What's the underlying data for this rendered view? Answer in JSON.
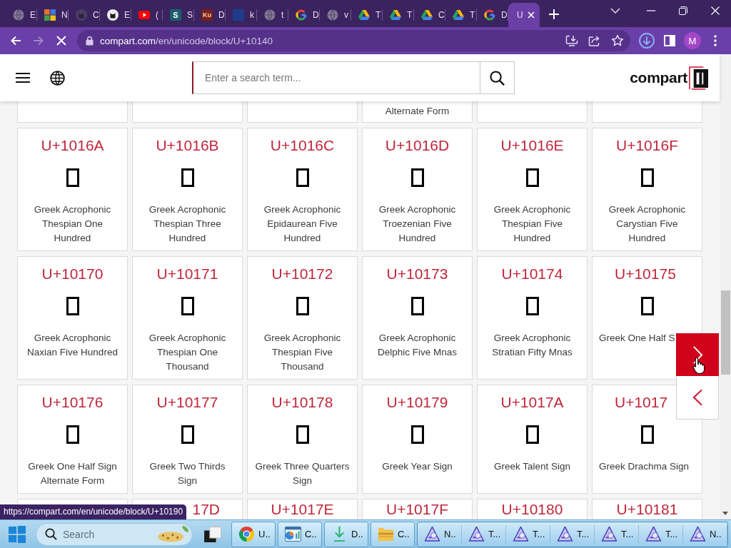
{
  "browser": {
    "tabs": [
      {
        "title": "E",
        "selected": false
      },
      {
        "title": "N",
        "selected": false
      },
      {
        "title": "C",
        "selected": false
      },
      {
        "title": "E",
        "selected": false
      },
      {
        "title": "(",
        "selected": false
      },
      {
        "title": "S",
        "logo_text": "S",
        "selected": false
      },
      {
        "title": "D",
        "logo_text": "Ku",
        "selected": false
      },
      {
        "title": "k",
        "selected": false
      },
      {
        "title": "t",
        "selected": false
      },
      {
        "title": "D",
        "selected": false
      },
      {
        "title": "v",
        "selected": false
      },
      {
        "title": "T",
        "selected": false
      },
      {
        "title": "T",
        "selected": false
      },
      {
        "title": "C",
        "selected": false
      },
      {
        "title": "T",
        "selected": false
      },
      {
        "title": "D",
        "selected": false
      },
      {
        "title": "U",
        "selected": true
      }
    ],
    "forward_disabled": true,
    "loading": true,
    "address": {
      "host": "compart.com",
      "path": "/en/unicode/block/U+10140"
    },
    "profile_initial": "M"
  },
  "site_header": {
    "search_placeholder": "Enter a search term...",
    "logo": "compart"
  },
  "cards": [
    {
      "kind": "tail"
    },
    {
      "kind": "tail"
    },
    {
      "kind": "tail"
    },
    {
      "kind": "tail",
      "name": "Alternate Form",
      "start_hidden": false,
      "end_hidden": false
    },
    {
      "kind": "tail"
    },
    {
      "kind": "tail"
    },
    {
      "kind": "full",
      "code": "U+1016A",
      "name": "Greek Acrophonic Thespian One Hundred",
      "start_hidden": false,
      "end_hidden": false
    },
    {
      "kind": "full",
      "code": "U+1016B",
      "name": "Greek Acrophonic Thespian Three Hundred",
      "start_hidden": false,
      "end_hidden": false
    },
    {
      "kind": "full",
      "code": "U+1016C",
      "name": "Greek Acrophonic Epidaurean Five Hundred",
      "start_hidden": false,
      "end_hidden": false
    },
    {
      "kind": "full",
      "code": "U+1016D",
      "name": "Greek Acrophonic Troezenian Five Hundred",
      "start_hidden": false,
      "end_hidden": false
    },
    {
      "kind": "full",
      "code": "U+1016E",
      "name": "Greek Acrophonic Thespian Five Hundred",
      "start_hidden": false,
      "end_hidden": false
    },
    {
      "kind": "full",
      "code": "U+1016F",
      "name": "Greek Acrophonic Carystian Five Hundred",
      "start_hidden": false,
      "end_hidden": false
    },
    {
      "kind": "full",
      "code": "U+10170",
      "name": "Greek Acrophonic Naxian Five Hundred",
      "start_hidden": false,
      "end_hidden": false
    },
    {
      "kind": "full",
      "code": "U+10171",
      "name": "Greek Acrophonic Thespian One Thousand",
      "start_hidden": false,
      "end_hidden": false
    },
    {
      "kind": "full",
      "code": "U+10172",
      "name": "Greek Acrophonic Thespian Five Thousand",
      "start_hidden": false,
      "end_hidden": false
    },
    {
      "kind": "full",
      "code": "U+10173",
      "name": "Greek Acrophonic Delphic Five Mnas",
      "start_hidden": false,
      "end_hidden": false
    },
    {
      "kind": "full",
      "code": "U+10174",
      "name": "Greek Acrophonic Stratian Fifty Mnas",
      "start_hidden": false,
      "end_hidden": false
    },
    {
      "kind": "full",
      "code": "U+10175",
      "name": "Greek One Half S",
      "start_hidden": false,
      "end_hidden": true
    },
    {
      "kind": "full",
      "code": "U+10176",
      "name": "Greek One Half Sign Alternate Form",
      "start_hidden": false,
      "end_hidden": false
    },
    {
      "kind": "full",
      "code": "U+10177",
      "name": "Greek Two Thirds Sign",
      "start_hidden": false,
      "end_hidden": false
    },
    {
      "kind": "full",
      "code": "U+10178",
      "name": "Greek Three Quarters Sign",
      "start_hidden": false,
      "end_hidden": false
    },
    {
      "kind": "full",
      "code": "U+10179",
      "name": "Greek Year Sign",
      "start_hidden": false,
      "end_hidden": false
    },
    {
      "kind": "full",
      "code": "U+1017A",
      "name": "Greek Talent Sign",
      "start_hidden": false,
      "end_hidden": false
    },
    {
      "kind": "full",
      "code": "U+1017",
      "name": "Greek Drachma Sign",
      "start_hidden": false,
      "end_hidden": true
    },
    {
      "kind": "head"
    },
    {
      "kind": "head",
      "code": "17D",
      "start_hidden": true,
      "end_hidden": false
    },
    {
      "kind": "head",
      "code": "U+1017E",
      "start_hidden": false,
      "end_hidden": false
    },
    {
      "kind": "head",
      "code": "U+1017F",
      "start_hidden": false,
      "end_hidden": false
    },
    {
      "kind": "head",
      "code": "U+10180",
      "start_hidden": false,
      "end_hidden": false
    },
    {
      "kind": "head",
      "code": "U+10181",
      "start_hidden": false,
      "end_hidden": false
    }
  ],
  "status_url": "https://compart.com/en/unicode/block/U+10190",
  "taskbar": {
    "search_placeholder": "Search",
    "apps": [
      {
        "label": "U.."
      },
      {
        "label": "C.."
      },
      {
        "label": "D.."
      },
      {
        "label": "C.."
      }
    ],
    "app_group": [
      {
        "label": "N.."
      },
      {
        "label": "T..."
      },
      {
        "label": "T..."
      },
      {
        "label": "T..."
      },
      {
        "label": "T..."
      },
      {
        "label": "T..."
      },
      {
        "label": "N.."
      }
    ]
  }
}
